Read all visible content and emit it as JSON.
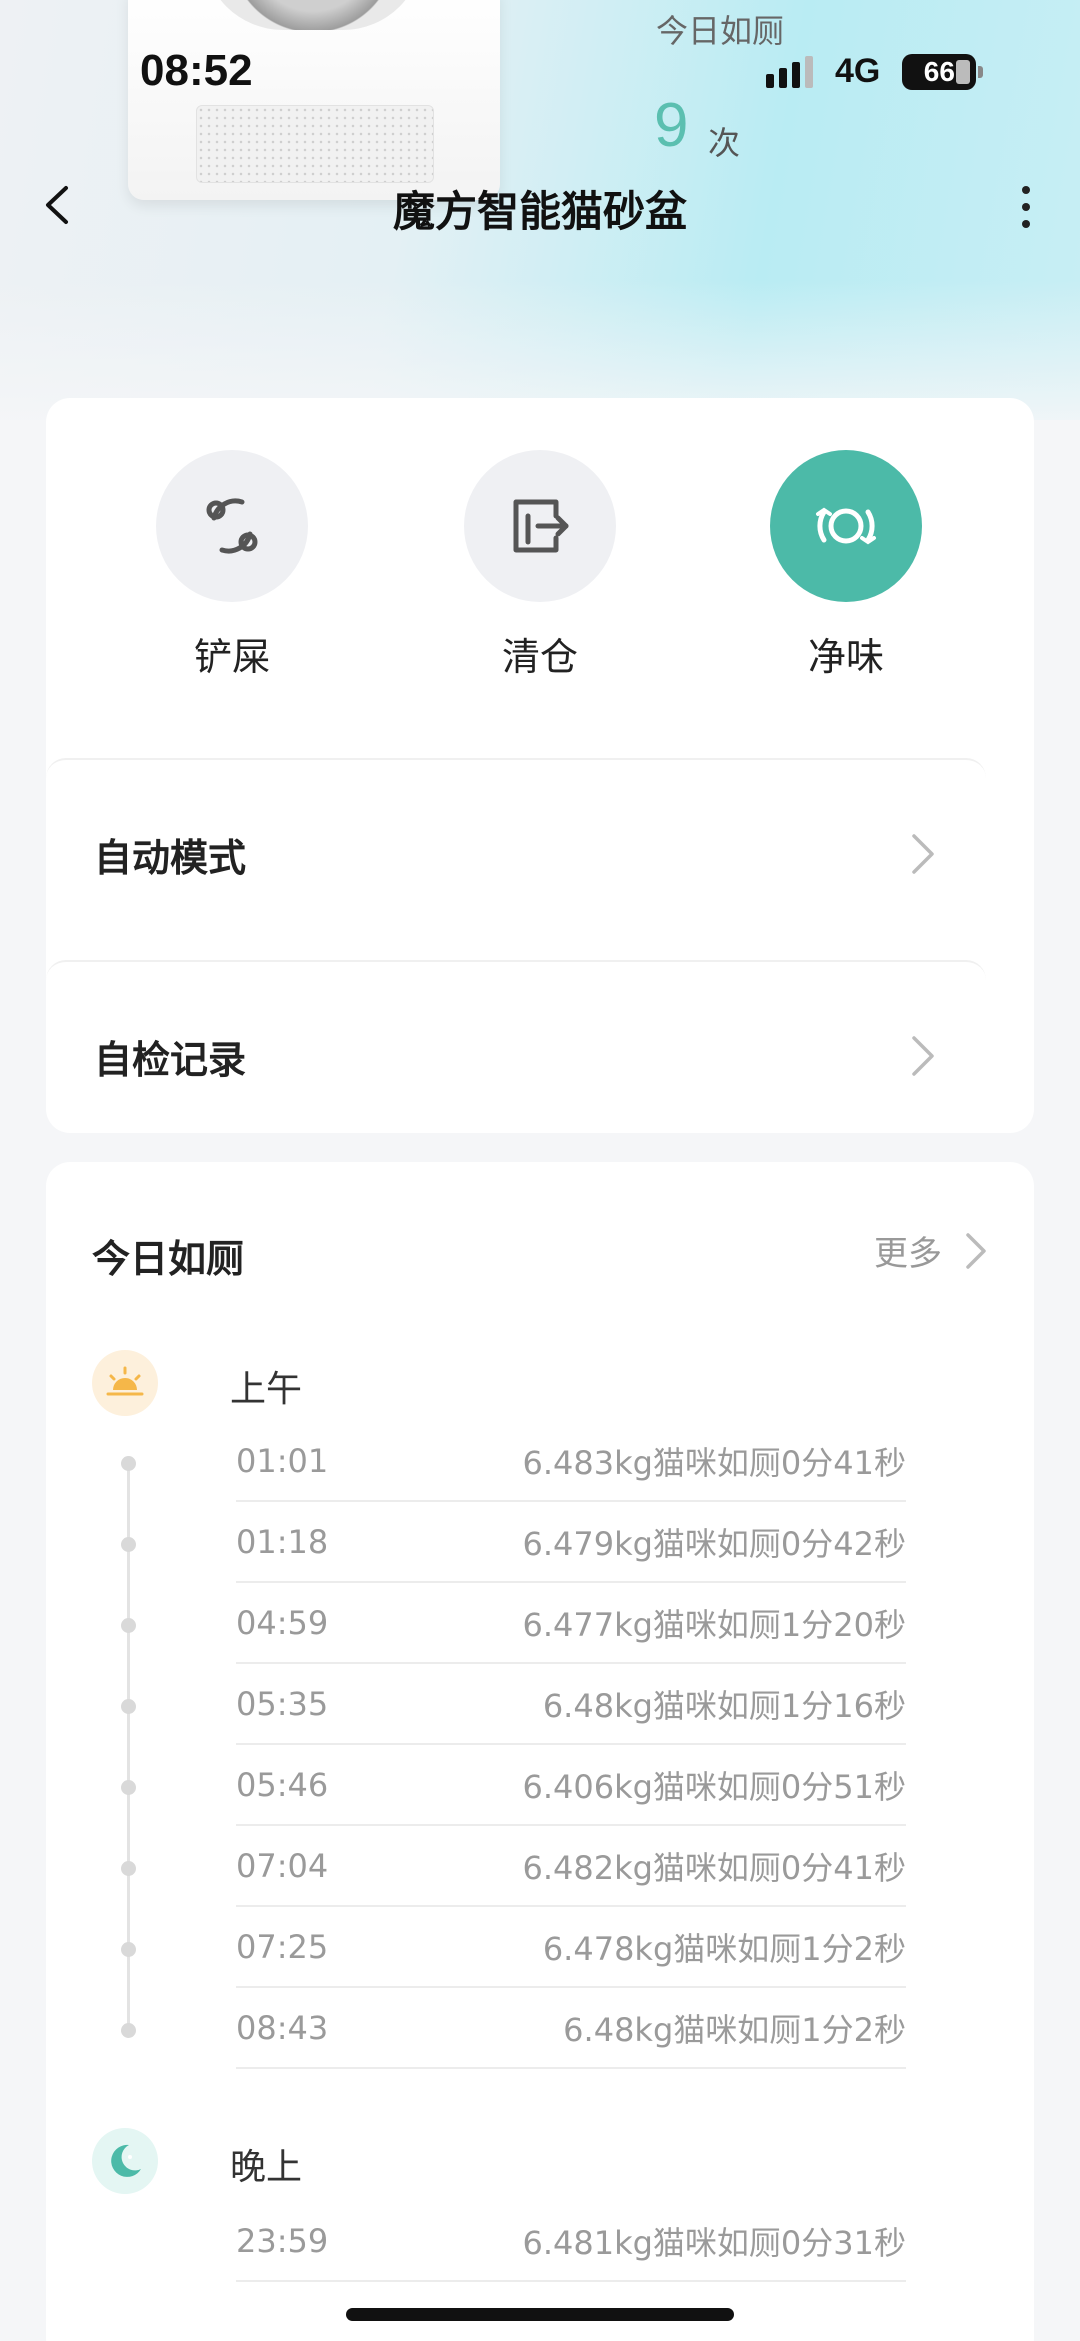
{
  "status_bar": {
    "time": "08:52",
    "network": "4G",
    "battery": "66"
  },
  "hero": {
    "stat_label": "今日如厕",
    "stat_value": "9",
    "stat_unit": "次"
  },
  "header": {
    "title": "魔方智能猫砂盆",
    "back_icon": "chevron-left-icon",
    "more_icon": "more-vertical-icon"
  },
  "actions": [
    {
      "label": "铲屎",
      "icon": "scoop-icon",
      "active": false
    },
    {
      "label": "清仓",
      "icon": "empty-bin-icon",
      "active": false
    },
    {
      "label": "净味",
      "icon": "deodorize-icon",
      "active": true
    }
  ],
  "menu": [
    {
      "label": "自动模式"
    },
    {
      "label": "自检记录"
    }
  ],
  "log": {
    "title": "今日如厕",
    "more": "更多",
    "periods": [
      {
        "label": "上午",
        "icon": "sunrise-icon",
        "entries": [
          {
            "time": "01:01",
            "detail": "6.483kg猫咪如厕0分41秒"
          },
          {
            "time": "01:18",
            "detail": "6.479kg猫咪如厕0分42秒"
          },
          {
            "time": "04:59",
            "detail": "6.477kg猫咪如厕1分20秒"
          },
          {
            "time": "05:35",
            "detail": "6.48kg猫咪如厕1分16秒"
          },
          {
            "time": "05:46",
            "detail": "6.406kg猫咪如厕0分51秒"
          },
          {
            "time": "07:04",
            "detail": "6.482kg猫咪如厕0分41秒"
          },
          {
            "time": "07:25",
            "detail": "6.478kg猫咪如厕1分2秒"
          },
          {
            "time": "08:43",
            "detail": "6.48kg猫咪如厕1分2秒"
          }
        ]
      },
      {
        "label": "晚上",
        "icon": "moon-icon",
        "entries": [
          {
            "time": "23:59",
            "detail": "6.481kg猫咪如厕0分31秒"
          }
        ]
      }
    ]
  },
  "colors": {
    "accent": "#4cbaa8",
    "stat": "#5bbfb0",
    "morning_icon_bg": "#fdf0dc",
    "night_icon_bg": "#e4f6f3"
  }
}
